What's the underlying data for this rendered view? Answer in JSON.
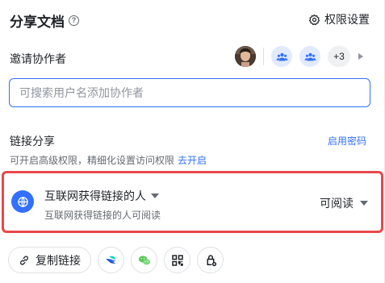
{
  "header": {
    "title": "分享文档",
    "help_symbol": "?",
    "permission_settings_label": "权限设置"
  },
  "invite": {
    "label": "邀请协作者",
    "more_count": "+3"
  },
  "search": {
    "placeholder": "可搜索用户名添加协作者"
  },
  "link_share": {
    "title": "链接分享",
    "enable_password_label": "启用密码",
    "description": "可开启高级权限，精细化设置访问权限",
    "go_enable_label": "去开启"
  },
  "link_card": {
    "scope_label": "互联网获得链接的人",
    "scope_description": "互联网获得链接的人可阅读",
    "permission_label": "可阅读"
  },
  "actions": {
    "copy_link_label": "复制链接"
  },
  "colors": {
    "accent": "#3370ff",
    "highlight_border": "#e8484b",
    "avatar_group_bg": "#e1eaff"
  },
  "icons": [
    "help-icon",
    "gear-icon",
    "group-icon",
    "chevron-right-icon",
    "globe-icon",
    "caret-down-icon",
    "link-icon",
    "feishu-icon",
    "wechat-icon",
    "qrcode-icon",
    "lock-share-icon"
  ]
}
